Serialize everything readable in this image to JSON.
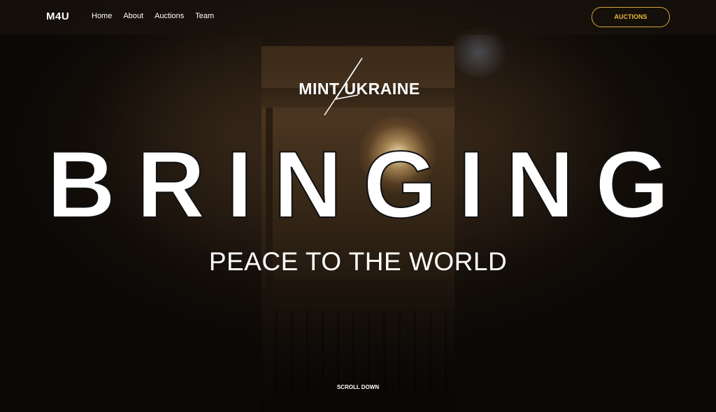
{
  "navbar": {
    "logo": "M4U",
    "links": [
      {
        "label": "Home"
      },
      {
        "label": "About"
      },
      {
        "label": "Auctions"
      },
      {
        "label": "Team"
      }
    ],
    "cta_label": "AUCTIONS"
  },
  "hero": {
    "brand_logo_text": "MINT  UKRAINE",
    "brand_logo_glyph": "4",
    "title": "BRINGING",
    "subtitle": "PEACE TO THE WORLD",
    "scroll_label": "SCROLL DOWN"
  },
  "colors": {
    "accent": "#e8b737",
    "text": "#ffffff",
    "background": "#120d08"
  }
}
